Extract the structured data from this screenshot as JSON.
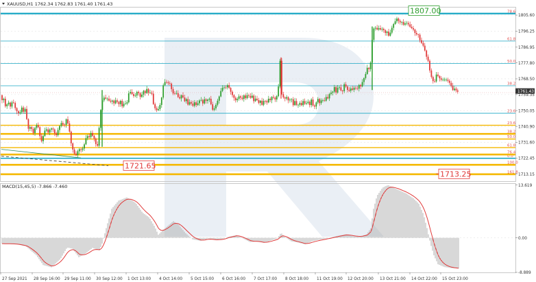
{
  "header": {
    "symbol_line": "XAUUSD,H1  1762.34 1762.83 1761.40 1761.43",
    "indicator_line": "MACD(15,45,5) -7.866 -7.460"
  },
  "colors": {
    "bull": "#2e9e2e",
    "bear": "#e03a3a",
    "fib_upper": "#1aa7c4",
    "fib_lower": "#f5b800",
    "fib_label": "#e05050",
    "macd_hist": "#a8a8a8",
    "signal": "#e03a3a",
    "trend": "#2e8b57",
    "grid": "#e4e4e4",
    "watermark": "#dfe6ef"
  },
  "chart_data": [
    {
      "type": "candlestick",
      "symbol": "XAUUSD",
      "timeframe": "H1",
      "ylim": [
        1709,
        1810
      ],
      "y_ticks": [
        1805.6,
        1796.25,
        1786.95,
        1777.8,
        1768.5,
        1759.35,
        1750.05,
        1740.9,
        1731.6,
        1722.45,
        1713.15
      ],
      "x_ticks": [
        "27 Sep 2021",
        "28 Sep 16:00",
        "29 Sep 11:00",
        "30 Sep 12:00",
        "1 Oct 13:00",
        "4 Oct 14:00",
        "5 Oct 15:00",
        "6 Oct 16:00",
        "7 Oct 17:00",
        "8 Oct 18:00",
        "11 Oct 19:00",
        "12 Oct 20:00",
        "13 Oct 21:00",
        "14 Oct 22:00",
        "15 Oct 23:00"
      ],
      "current_price": "1761.43",
      "price_path": [
        [
          0,
          1759
        ],
        [
          2,
          1756
        ],
        [
          5,
          1757
        ],
        [
          8,
          1751
        ],
        [
          11,
          1756
        ],
        [
          14,
          1752
        ],
        [
          18,
          1756
        ],
        [
          22,
          1751
        ],
        [
          25,
          1749
        ],
        [
          28,
          1748
        ],
        [
          31,
          1752
        ],
        [
          34,
          1749
        ],
        [
          36,
          1751
        ],
        [
          38,
          1746
        ],
        [
          41,
          1739
        ],
        [
          44,
          1741
        ],
        [
          48,
          1737
        ],
        [
          52,
          1742
        ],
        [
          56,
          1740
        ],
        [
          59,
          1731
        ],
        [
          63,
          1736
        ],
        [
          66,
          1740
        ],
        [
          70,
          1737
        ],
        [
          73,
          1740
        ],
        [
          77,
          1739
        ],
        [
          81,
          1735
        ],
        [
          85,
          1740
        ],
        [
          89,
          1743
        ],
        [
          93,
          1741
        ],
        [
          96,
          1745
        ],
        [
          100,
          1741
        ],
        [
          102,
          1733
        ],
        [
          105,
          1728
        ],
        [
          108,
          1725
        ],
        [
          111,
          1724
        ],
        [
          114,
          1728
        ],
        [
          117,
          1727
        ],
        [
          120,
          1728
        ],
        [
          123,
          1731
        ],
        [
          126,
          1736
        ],
        [
          129,
          1734
        ],
        [
          132,
          1737
        ],
        [
          135,
          1735
        ],
        [
          138,
          1733
        ],
        [
          141,
          1727
        ],
        [
          144,
          1740
        ],
        [
          147,
          1753
        ],
        [
          150,
          1758
        ],
        [
          153,
          1757
        ],
        [
          156,
          1757
        ],
        [
          160,
          1755
        ],
        [
          163,
          1756
        ],
        [
          166,
          1754
        ],
        [
          169,
          1757
        ],
        [
          172,
          1753
        ],
        [
          175,
          1756
        ],
        [
          178,
          1752
        ],
        [
          181,
          1755
        ],
        [
          184,
          1753
        ],
        [
          187,
          1760
        ],
        [
          190,
          1761
        ],
        [
          193,
          1759
        ],
        [
          196,
          1758
        ],
        [
          199,
          1761
        ],
        [
          202,
          1760
        ],
        [
          205,
          1757
        ],
        [
          208,
          1762
        ],
        [
          211,
          1760
        ],
        [
          214,
          1763
        ],
        [
          217,
          1759
        ],
        [
          220,
          1762
        ],
        [
          223,
          1754
        ],
        [
          226,
          1751
        ],
        [
          229,
          1750
        ],
        [
          232,
          1752
        ],
        [
          235,
          1757
        ],
        [
          238,
          1766
        ],
        [
          241,
          1767
        ],
        [
          244,
          1766
        ],
        [
          247,
          1766
        ],
        [
          250,
          1762
        ],
        [
          253,
          1759
        ],
        [
          256,
          1761
        ],
        [
          259,
          1758
        ],
        [
          262,
          1757
        ],
        [
          265,
          1760
        ],
        [
          268,
          1755
        ],
        [
          271,
          1757
        ],
        [
          274,
          1753
        ],
        [
          277,
          1756
        ],
        [
          280,
          1752
        ],
        [
          283,
          1755
        ],
        [
          286,
          1753
        ],
        [
          289,
          1755
        ],
        [
          292,
          1757
        ],
        [
          295,
          1754
        ],
        [
          298,
          1757
        ],
        [
          301,
          1755
        ],
        [
          304,
          1758
        ],
        [
          307,
          1754
        ],
        [
          310,
          1750
        ],
        [
          313,
          1752
        ],
        [
          316,
          1755
        ],
        [
          319,
          1758
        ],
        [
          322,
          1762
        ],
        [
          325,
          1764
        ],
        [
          328,
          1763
        ],
        [
          331,
          1765
        ],
        [
          334,
          1763
        ],
        [
          337,
          1760
        ],
        [
          340,
          1758
        ],
        [
          343,
          1756
        ],
        [
          346,
          1757
        ],
        [
          349,
          1759
        ],
        [
          352,
          1756
        ],
        [
          355,
          1759
        ],
        [
          358,
          1757
        ],
        [
          361,
          1760
        ],
        [
          364,
          1757
        ],
        [
          367,
          1759
        ],
        [
          370,
          1755
        ],
        [
          373,
          1758
        ],
        [
          376,
          1754
        ],
        [
          379,
          1756
        ],
        [
          382,
          1753
        ],
        [
          385,
          1757
        ],
        [
          388,
          1754
        ],
        [
          391,
          1757
        ],
        [
          394,
          1756
        ],
        [
          397,
          1759
        ],
        [
          400,
          1756
        ],
        [
          403,
          1758
        ],
        [
          406,
          1765
        ],
        [
          408,
          1779
        ],
        [
          410,
          1760
        ],
        [
          412,
          1758
        ],
        [
          415,
          1757
        ],
        [
          418,
          1758
        ],
        [
          421,
          1755
        ],
        [
          424,
          1758
        ],
        [
          427,
          1753
        ],
        [
          430,
          1756
        ],
        [
          433,
          1752
        ],
        [
          436,
          1755
        ],
        [
          439,
          1753
        ],
        [
          442,
          1756
        ],
        [
          445,
          1753
        ],
        [
          448,
          1756
        ],
        [
          451,
          1753
        ],
        [
          454,
          1757
        ],
        [
          457,
          1751
        ],
        [
          460,
          1754
        ],
        [
          463,
          1757
        ],
        [
          466,
          1754
        ],
        [
          469,
          1757
        ],
        [
          472,
          1755
        ],
        [
          475,
          1758
        ],
        [
          478,
          1757
        ],
        [
          481,
          1761
        ],
        [
          484,
          1760
        ],
        [
          487,
          1764
        ],
        [
          490,
          1760
        ],
        [
          493,
          1765
        ],
        [
          496,
          1762
        ],
        [
          499,
          1761
        ],
        [
          502,
          1766
        ],
        [
          505,
          1763
        ],
        [
          508,
          1761
        ],
        [
          511,
          1763
        ],
        [
          514,
          1762
        ],
        [
          517,
          1764
        ],
        [
          520,
          1762
        ],
        [
          523,
          1765
        ],
        [
          526,
          1764
        ],
        [
          529,
          1768
        ],
        [
          532,
          1770
        ],
        [
          535,
          1775
        ],
        [
          538,
          1774
        ],
        [
          541,
          1780
        ],
        [
          543,
          1796
        ],
        [
          546,
          1799
        ],
        [
          549,
          1797
        ],
        [
          552,
          1798
        ],
        [
          555,
          1797
        ],
        [
          558,
          1798
        ],
        [
          561,
          1795
        ],
        [
          564,
          1796
        ],
        [
          567,
          1793
        ],
        [
          570,
          1797
        ],
        [
          573,
          1800
        ],
        [
          576,
          1802
        ],
        [
          579,
          1804
        ],
        [
          582,
          1801
        ],
        [
          585,
          1802
        ],
        [
          588,
          1800
        ],
        [
          591,
          1801
        ],
        [
          594,
          1801
        ],
        [
          597,
          1799
        ],
        [
          600,
          1798
        ],
        [
          603,
          1797
        ],
        [
          606,
          1794
        ],
        [
          609,
          1795
        ],
        [
          612,
          1791
        ],
        [
          615,
          1789
        ],
        [
          618,
          1787
        ],
        [
          621,
          1782
        ],
        [
          624,
          1779
        ],
        [
          627,
          1772
        ],
        [
          630,
          1768
        ],
        [
          633,
          1766
        ],
        [
          636,
          1771
        ],
        [
          639,
          1770
        ],
        [
          642,
          1768
        ],
        [
          645,
          1768
        ],
        [
          648,
          1768
        ],
        [
          651,
          1768
        ],
        [
          654,
          1767
        ],
        [
          657,
          1765
        ],
        [
          660,
          1762
        ],
        [
          663,
          1763
        ],
        [
          666,
          1761
        ]
      ]
    },
    {
      "type": "fibonacci-levels",
      "groups": [
        {
          "name": "upper",
          "levels": [
            {
              "label": "78.6",
              "price": 1806.5
            },
            {
              "label": "61.8",
              "price": 1790.5
            },
            {
              "label": "50.0",
              "price": 1777.5
            },
            {
              "label": "38.2",
              "price": 1764.5
            },
            {
              "label": "23.6",
              "price": 1748.5
            },
            {
              "label": "0.0",
              "price": 1722.3
            }
          ]
        },
        {
          "name": "lower",
          "levels": [
            {
              "label": "23.6",
              "price": 1741.5
            },
            {
              "label": "38.2",
              "price": 1736.5
            },
            {
              "label": "50.0",
              "price": 1733.5
            },
            {
              "label": "61.8",
              "price": 1728.5
            },
            {
              "label": "76.4",
              "price": 1724.5
            },
            {
              "label": "100.0",
              "price": 1718.5
            },
            {
              "label": "161.8",
              "price": 1713.0
            }
          ]
        }
      ]
    },
    {
      "type": "annotations",
      "items": [
        {
          "text": "1807.00",
          "price": 1807.0,
          "color": "#2e9e2e"
        },
        {
          "text": "1721.65",
          "price": 1721.65,
          "color": "#e03a3a"
        },
        {
          "text": "1713.25",
          "price": 1713.25,
          "color": "#e03a3a"
        }
      ]
    },
    {
      "type": "macd",
      "params": "MACD(15,45,5)",
      "values_text": "-7.866 -7.460",
      "ylim": [
        -8.9,
        13.9
      ],
      "y_ticks": [
        13.619,
        0.0,
        -8.889
      ],
      "y_tick_labels": [
        "13.619",
        "0.00",
        "-8.889"
      ],
      "hist_path": [
        [
          0,
          -1.5
        ],
        [
          20,
          -1.6
        ],
        [
          35,
          -2.2
        ],
        [
          50,
          -4.5
        ],
        [
          60,
          -7.0
        ],
        [
          72,
          -7.6
        ],
        [
          85,
          -5.5
        ],
        [
          95,
          -2.5
        ],
        [
          103,
          -2.8
        ],
        [
          112,
          -5.0
        ],
        [
          122,
          -4.0
        ],
        [
          132,
          -2.6
        ],
        [
          142,
          -3.2
        ],
        [
          146,
          -1.5
        ],
        [
          152,
          2.5
        ],
        [
          160,
          7.5
        ],
        [
          170,
          9.6
        ],
        [
          182,
          10.4
        ],
        [
          195,
          9.0
        ],
        [
          205,
          6.5
        ],
        [
          215,
          5.2
        ],
        [
          223,
          2.8
        ],
        [
          228,
          0.8
        ],
        [
          238,
          2.5
        ],
        [
          250,
          4.3
        ],
        [
          258,
          3.3
        ],
        [
          268,
          1.2
        ],
        [
          278,
          -0.4
        ],
        [
          290,
          -0.8
        ],
        [
          300,
          -0.2
        ],
        [
          312,
          -0.6
        ],
        [
          322,
          -0.3
        ],
        [
          330,
          0.3
        ],
        [
          342,
          0.7
        ],
        [
          352,
          -0.2
        ],
        [
          362,
          -1.1
        ],
        [
          372,
          -0.9
        ],
        [
          382,
          -1.3
        ],
        [
          392,
          -0.7
        ],
        [
          402,
          -0.1
        ],
        [
          407,
          1.3
        ],
        [
          412,
          0.3
        ],
        [
          422,
          -0.9
        ],
        [
          432,
          -1.2
        ],
        [
          442,
          -1.7
        ],
        [
          452,
          -0.9
        ],
        [
          462,
          -0.5
        ],
        [
          472,
          -0.2
        ],
        [
          482,
          0.2
        ],
        [
          492,
          0.6
        ],
        [
          502,
          0.9
        ],
        [
          512,
          0.4
        ],
        [
          522,
          0.3
        ],
        [
          532,
          0.9
        ],
        [
          538,
          2.5
        ],
        [
          542,
          7.5
        ],
        [
          547,
          10.8
        ],
        [
          555,
          12.9
        ],
        [
          563,
          13.6
        ],
        [
          575,
          12.6
        ],
        [
          590,
          11.4
        ],
        [
          600,
          10.2
        ],
        [
          608,
          8.8
        ],
        [
          615,
          6.0
        ],
        [
          620,
          2.5
        ],
        [
          625,
          -1.5
        ],
        [
          630,
          -4.5
        ],
        [
          636,
          -6.8
        ],
        [
          645,
          -7.5
        ],
        [
          655,
          -7.8
        ],
        [
          666,
          -7.9
        ]
      ]
    }
  ]
}
